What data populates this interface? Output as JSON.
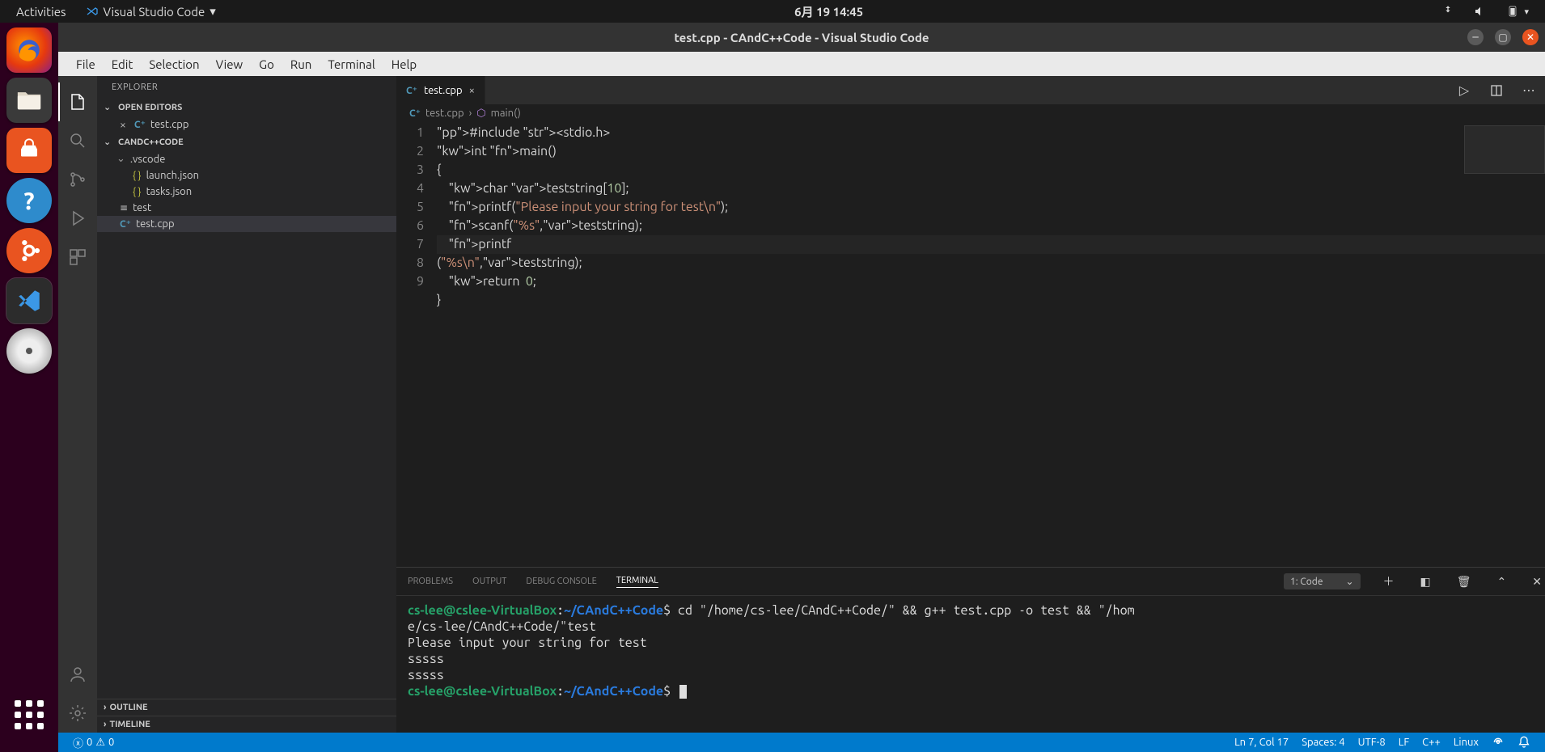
{
  "gnome": {
    "activities": "Activities",
    "appmenu": "Visual Studio Code",
    "clock": "6月 19  14:45"
  },
  "launcher": {
    "apps": [
      "firefox",
      "files",
      "software",
      "help",
      "ubuntu",
      "vscode",
      "disk"
    ]
  },
  "window": {
    "title": "test.cpp - CAndC++Code - Visual Studio Code"
  },
  "menubar": [
    "File",
    "Edit",
    "Selection",
    "View",
    "Go",
    "Run",
    "Terminal",
    "Help"
  ],
  "explorer": {
    "header": "EXPLORER",
    "openEditors": {
      "title": "OPEN EDITORS",
      "items": [
        {
          "name": "test.cpp",
          "type": "cpp"
        }
      ]
    },
    "folder": {
      "title": "CANDC++CODE",
      "children": [
        {
          "name": ".vscode",
          "type": "folder",
          "children": [
            {
              "name": "launch.json",
              "type": "json"
            },
            {
              "name": "tasks.json",
              "type": "json"
            }
          ]
        },
        {
          "name": "test",
          "type": "lines"
        },
        {
          "name": "test.cpp",
          "type": "cpp",
          "selected": true
        }
      ]
    },
    "outline": "OUTLINE",
    "timeline": "TIMELINE"
  },
  "editor": {
    "tab": {
      "name": "test.cpp"
    },
    "breadcrumb": [
      "test.cpp",
      "main()"
    ],
    "lines": [
      "#include <stdio.h>",
      "int main()",
      "{",
      "    char teststring[10];",
      "    printf(\"Please input your string for test\\n\");",
      "    scanf(\"%s\",teststring);",
      "    printf(\"%s\\n\",teststring);",
      "    return  0;",
      "}"
    ]
  },
  "panel": {
    "tabs": {
      "problems": "PROBLEMS",
      "output": "OUTPUT",
      "debug": "DEBUG CONSOLE",
      "terminal": "TERMINAL"
    },
    "activeTab": "terminal",
    "terminal": {
      "selector": "1: Code",
      "promptUser": "cs-lee@cslee-VirtualBox",
      "promptPath": "~/CAndC++Code",
      "cmd1": "cd \"/home/cs-lee/CAndC++Code/\" && g++ test.cpp -o test && \"/home/cs-lee/CAndC++Code/\"test",
      "out1": "Please input your string for test",
      "out2": "sssss",
      "out3": "sssss"
    }
  },
  "status": {
    "errors": "0",
    "warnings": "0",
    "lncol": "Ln 7, Col 17",
    "spaces": "Spaces: 4",
    "encoding": "UTF-8",
    "eol": "LF",
    "lang": "C++",
    "os": "Linux"
  }
}
